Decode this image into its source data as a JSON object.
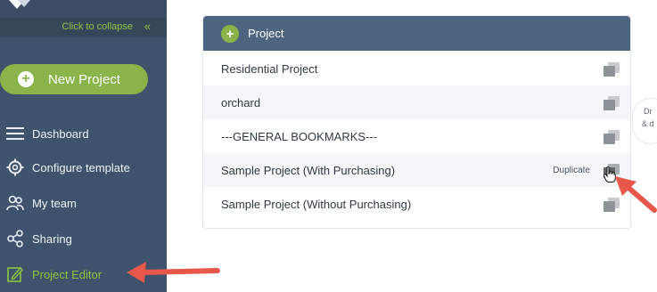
{
  "sidebar": {
    "collapse_label": "Click to collapse",
    "collapse_icon": "double-chevron-left-icon",
    "new_project_label": "New Project",
    "items": [
      {
        "label": "Dashboard",
        "icon": "menu-icon"
      },
      {
        "label": "Configure template",
        "icon": "gear-icon"
      },
      {
        "label": "My team",
        "icon": "team-icon"
      },
      {
        "label": "Sharing",
        "icon": "share-icon"
      },
      {
        "label": "Project Editor",
        "icon": "edit-icon",
        "active": true
      }
    ]
  },
  "project_card": {
    "header_label": "Project",
    "rows": [
      {
        "label": "Residential Project"
      },
      {
        "label": "orchard"
      },
      {
        "label": "---GENERAL BOOKMARKS---"
      },
      {
        "label": "Sample Project (With Purchasing)",
        "hover_label": "Duplicate"
      },
      {
        "label": "Sample Project (Without Purchasing)"
      }
    ]
  },
  "side_hint": {
    "line1": "Dr",
    "line2": "& d"
  },
  "colors": {
    "sidebar_bg": "#3f536d",
    "accent_green": "#8ab34a",
    "card_header_bg": "#4e6580",
    "arrow_red": "#e8584a"
  }
}
